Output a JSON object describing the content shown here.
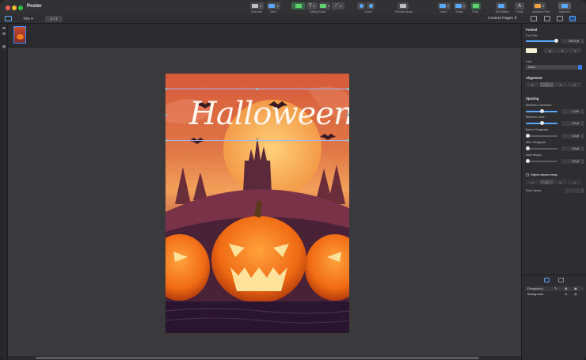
{
  "app": {
    "title": "Poster"
  },
  "toolbar": {
    "items": [
      {
        "label": "Barcode"
      },
      {
        "label": "View"
      },
      {
        "label": "Editing Tools"
      },
      {
        "label": "Zoom"
      },
      {
        "label": "Preview Mode"
      },
      {
        "label": "Insert"
      },
      {
        "label": "Share"
      },
      {
        "label": "Print"
      },
      {
        "label": "Text Styles"
      },
      {
        "label": "Fonts"
      },
      {
        "label": "Address Field"
      },
      {
        "label": "Inspector"
      }
    ]
  },
  "subbar": {
    "zoom": "70%",
    "page": "1 / 1",
    "content_pages": "Content Pages"
  },
  "poster": {
    "title": "Halloween"
  },
  "inspector": {
    "format": {
      "heading": "Format",
      "font_size_label": "Font Size",
      "font_size_value": "102,0 pt",
      "lists_label": "Lists",
      "lists_value": "None"
    },
    "alignment": {
      "heading": "Alignment"
    },
    "spacing": {
      "heading": "Spacing",
      "between_characters_label": "Between Characters",
      "between_characters_value": "0,0%",
      "between_lines_label": "Between Lines",
      "between_lines_value": "0,0 pt",
      "before_paragraph_label": "Before Paragraph",
      "before_paragraph_value": "0,0 pt",
      "after_paragraph_label": "After Paragraph",
      "after_paragraph_value": "0,0 pt",
      "inset_margin_label": "Inset Margin",
      "inset_margin_value": "0,0 pt",
      "object_wrap_label": "Object causes wrap",
      "extra_space_label": "Extra Space"
    },
    "layers": [
      {
        "label": "Foreground"
      },
      {
        "label": "Background"
      }
    ]
  },
  "colors": {
    "accent": "#3d7cf0",
    "window_bg": "#2b2b2d"
  }
}
